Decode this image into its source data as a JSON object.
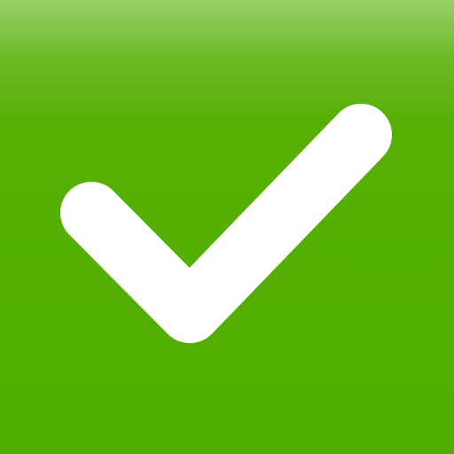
{
  "icon": {
    "name": "checkmark-icon",
    "foreground": "#ffffff",
    "background_top": "#9ad068",
    "background": "#50ad00"
  }
}
